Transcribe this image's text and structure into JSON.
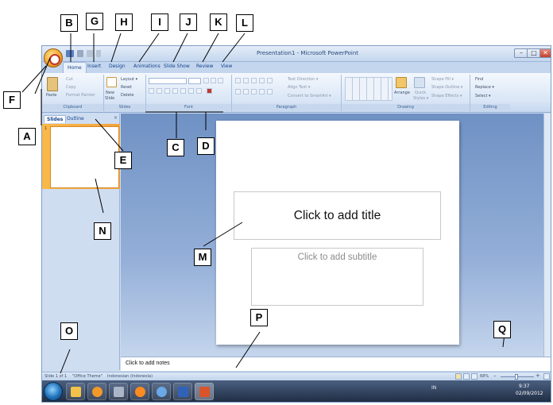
{
  "window": {
    "title": "Presentation1 - Microsoft PowerPoint",
    "controls": {
      "minimize": "–",
      "maximize": "□",
      "close": "✕"
    }
  },
  "tabs": [
    "Home",
    "Insert",
    "Design",
    "Animations",
    "Slide Show",
    "Review",
    "View"
  ],
  "ribbon": {
    "clipboard": {
      "label": "Clipboard",
      "paste": "Paste",
      "cut": "Cut",
      "copy": "Copy",
      "format_painter": "Format Painter"
    },
    "slides": {
      "label": "Slides",
      "new_slide_1": "New",
      "new_slide_2": "Slide",
      "layout": "Layout ▾",
      "reset": "Reset",
      "delete": "Delete"
    },
    "font": {
      "label": "Font"
    },
    "paragraph": {
      "label": "Paragraph",
      "text_direction": "Text Direction ▾",
      "align_text": "Align Text ▾",
      "convert_smartart": "Convert to SmartArt ▾"
    },
    "drawing": {
      "label": "Drawing",
      "arrange": "Arrange",
      "quick_styles_1": "Quick",
      "quick_styles_2": "Styles ▾",
      "shape_fill": "Shape Fill ▾",
      "shape_outline": "Shape Outline ▾",
      "shape_effects": "Shape Effects ▾"
    },
    "editing": {
      "label": "Editing",
      "find": "Find",
      "replace": "Replace ▾",
      "select": "Select ▾"
    }
  },
  "pane": {
    "tab_slides": "Slides",
    "tab_outline": "Outline",
    "close": "×",
    "thumb_number": "1"
  },
  "slide": {
    "title_placeholder": "Click to add title",
    "subtitle_placeholder": "Click to add subtitle"
  },
  "notes": {
    "placeholder": "Click to add notes"
  },
  "status": {
    "slide_count": "Slide 1 of 1",
    "theme": "\"Office Theme\"",
    "language": "Indonesian (Indonesia)",
    "zoom": "68%",
    "zoom_out": "–",
    "zoom_in": "+"
  },
  "taskbar": {
    "tray_lang": "IN",
    "time": "9:37",
    "date": "02/09/2012"
  },
  "callouts": [
    "A",
    "B",
    "C",
    "D",
    "E",
    "F",
    "G",
    "H",
    "I",
    "J",
    "K",
    "L",
    "M",
    "N",
    "O",
    "P",
    "Q"
  ],
  "colors": {
    "ribbon_text": "#15428b",
    "accent_orange": "#f4a23a",
    "editor_blue": "#6f91c4"
  }
}
